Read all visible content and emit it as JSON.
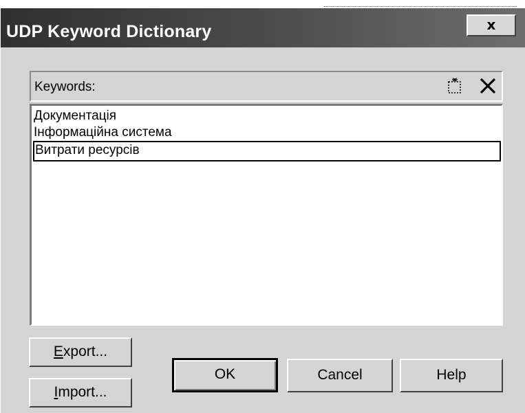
{
  "window": {
    "title": "UDP Keyword Dictionary",
    "close_glyph": "x"
  },
  "keywords": {
    "label": "Keywords:",
    "new_icon": "new-keyword-icon",
    "delete_icon": "delete-keyword-icon",
    "items": [
      {
        "label": "Документація",
        "selected": false
      },
      {
        "label": "Інформаційна система",
        "selected": false
      },
      {
        "label": "Витрати ресурсів",
        "selected": true
      }
    ]
  },
  "buttons": {
    "export": {
      "mnemonic": "E",
      "rest": "xport..."
    },
    "import": {
      "mnemonic": "I",
      "rest": "mport..."
    },
    "ok": "OK",
    "cancel": "Cancel",
    "help": "Help"
  },
  "colors": {
    "titlebar": "#4a4a4a",
    "dialog_bg": "#d4d4d4",
    "list_bg": "#ffffff"
  }
}
